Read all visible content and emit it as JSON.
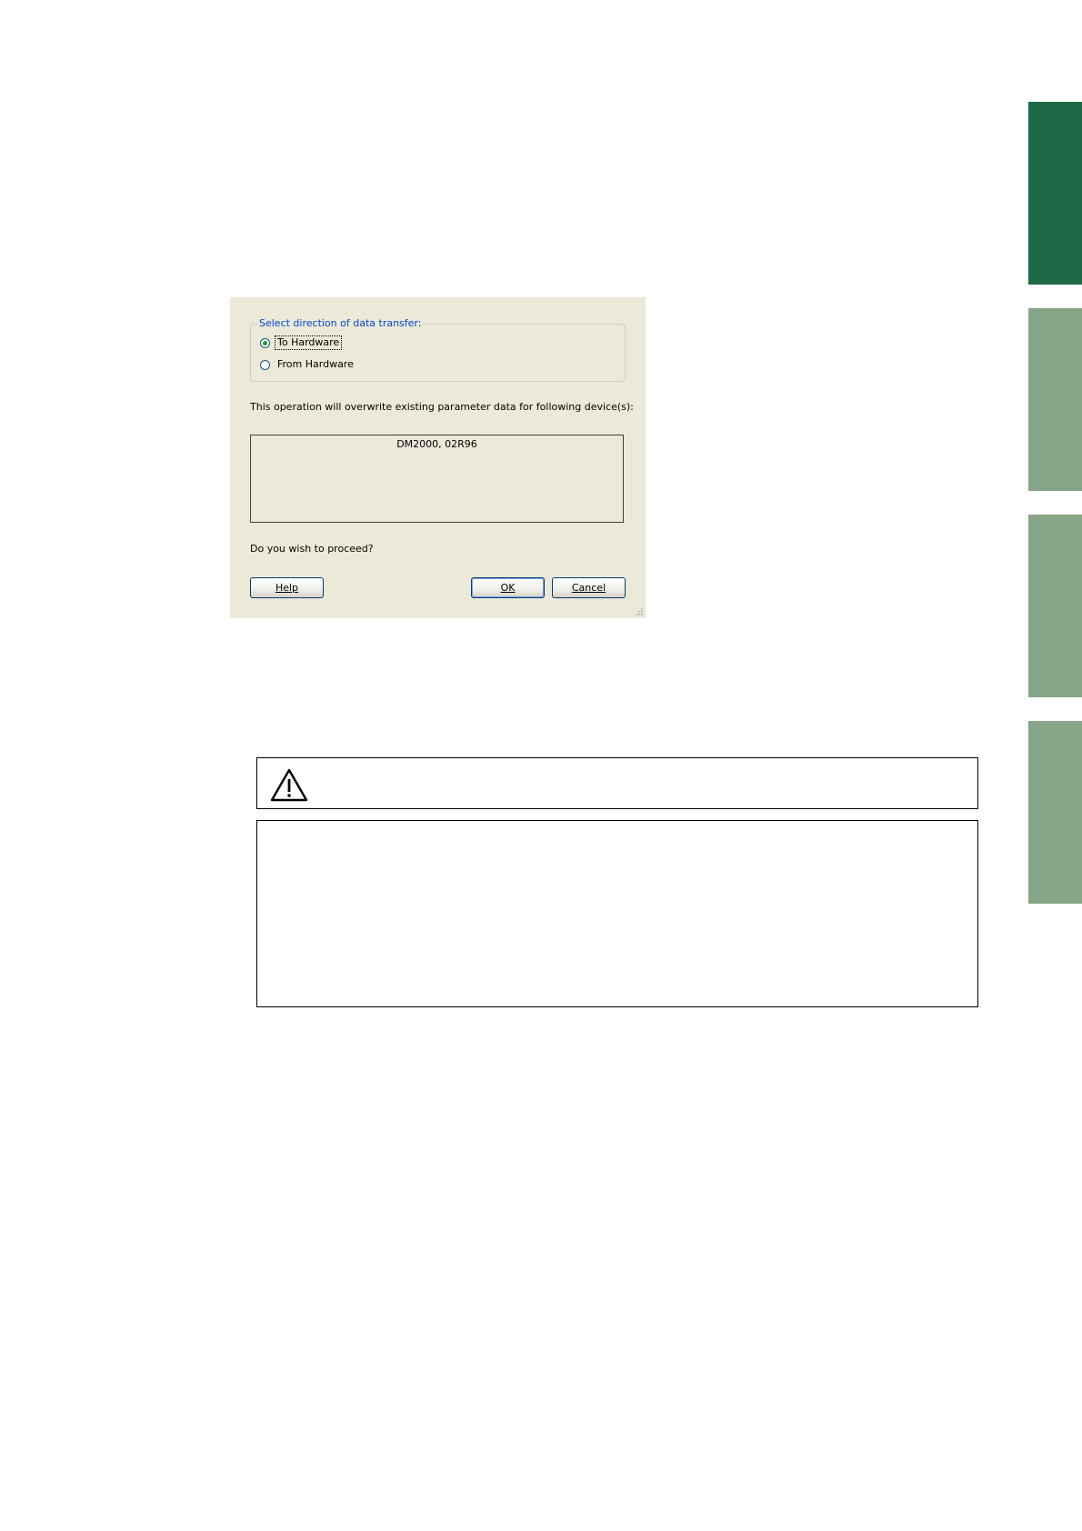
{
  "dialog": {
    "group_label": "Select direction of data transfer:",
    "options": [
      {
        "label": "To Hardware",
        "checked": true
      },
      {
        "label": "From Hardware",
        "checked": false
      }
    ],
    "message": "This operation will overwrite existing parameter data for following device(s):",
    "devices": "DM2000, 02R96",
    "question": "Do you wish to proceed?",
    "buttons": {
      "help": "Help",
      "ok": "OK",
      "cancel": "Cancel"
    }
  },
  "colors": {
    "tab_active": "#1e6a45",
    "tab_inactive": "#86a586",
    "dialog_bg": "#ece9d8",
    "group_label": "#0046d5"
  },
  "icons": {
    "caution": "warning-triangle-icon"
  }
}
